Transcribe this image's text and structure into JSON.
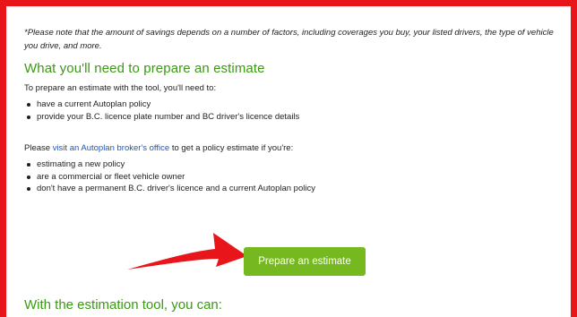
{
  "note": "*Please note that the amount of savings depends on a number of factors, including coverages you buy, your listed drivers, the type of vehicle you drive, and more.",
  "prepare_section": {
    "heading": "What you'll need to prepare an estimate",
    "intro": "To prepare an estimate with the tool, you'll need to:",
    "items": [
      "have a current Autoplan policy",
      "provide your B.C. licence plate number and BC driver's licence details"
    ]
  },
  "broker_section": {
    "lead": "Please ",
    "link_text": "visit an Autoplan broker's office",
    "trail": " to get a policy estimate if you're:",
    "items": [
      "estimating a new policy",
      "are a commercial or fleet vehicle owner",
      "don't have a permanent B.C. driver's licence and a current Autoplan policy"
    ]
  },
  "cta": {
    "label": "Prepare an estimate"
  },
  "tool_section": {
    "heading": "With the estimation tool, you can:"
  },
  "colors": {
    "frame": "#e8151b",
    "heading": "#3a9a12",
    "button": "#76b820",
    "link": "#1a56c7"
  }
}
